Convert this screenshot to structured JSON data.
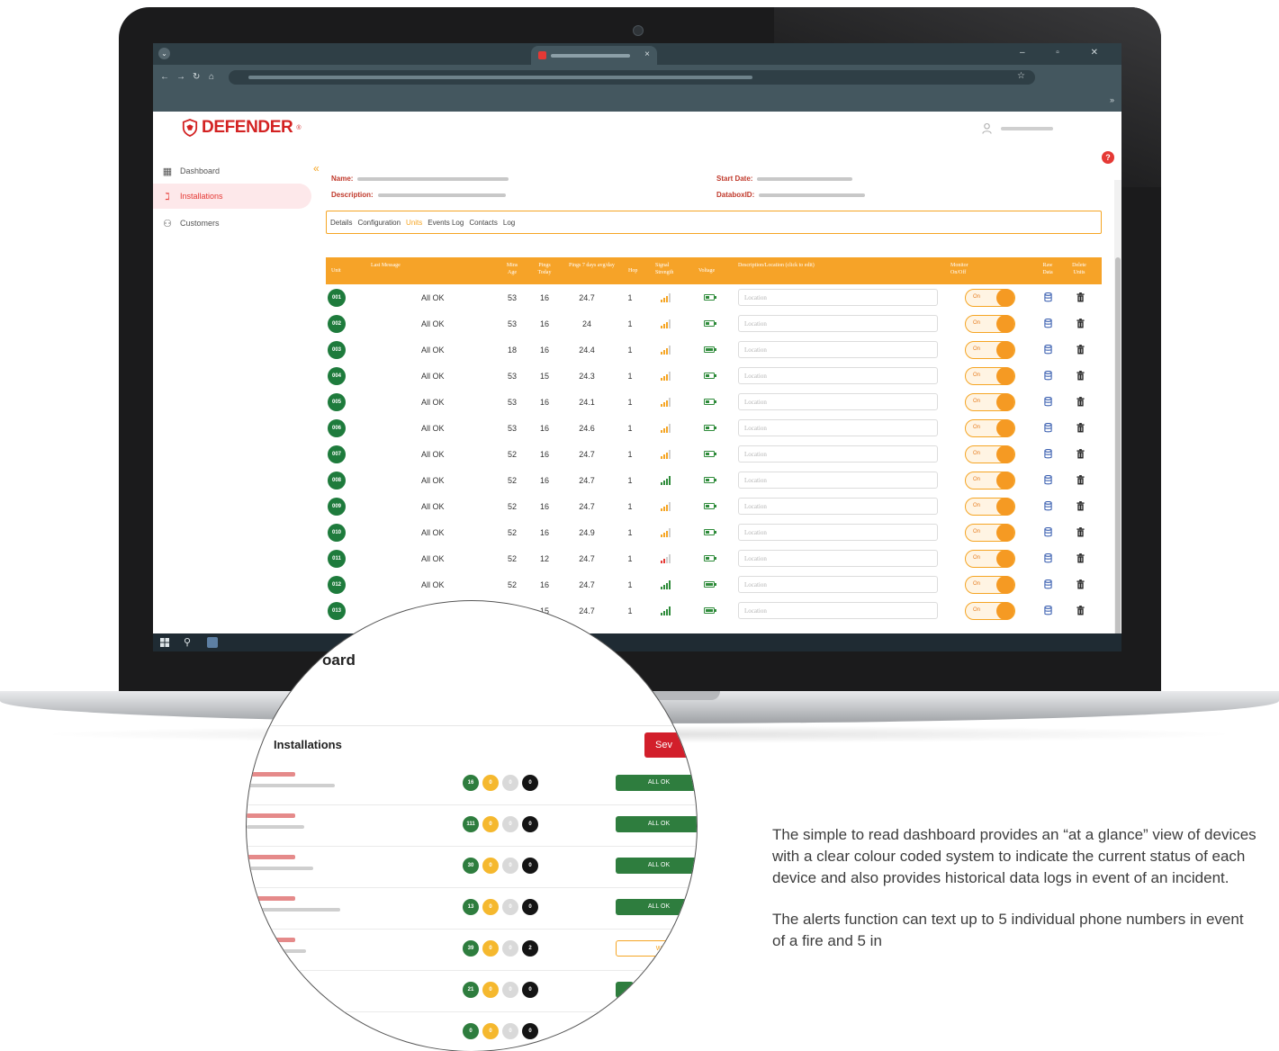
{
  "browser": {
    "window_controls": "–   ▫   ✕",
    "tab_close": "×"
  },
  "app": {
    "brand": "DEFENDER",
    "brand_mark": "®",
    "help_label": "?",
    "sidebar": [
      {
        "label": "Dashboard",
        "icon": "dashboard-grid-icon"
      },
      {
        "label": "Installations",
        "icon": "feed-icon",
        "active": true
      },
      {
        "label": "Customers",
        "icon": "users-icon"
      }
    ],
    "collapse_glyph": "«",
    "installation": {
      "name_key": "Name:",
      "description_key": "Description:",
      "start_date_key": "Start Date:",
      "databox_key": "DataboxID:"
    },
    "tabs": [
      {
        "label": "Details"
      },
      {
        "label": "Configuration"
      },
      {
        "label": "Units",
        "active": true
      },
      {
        "label": "Events Log"
      },
      {
        "label": "Contacts"
      },
      {
        "label": "Log"
      }
    ],
    "table": {
      "headers": {
        "unit": "Unit",
        "last_message": "Last Message",
        "mins_age": "Mins Age",
        "pings_today": "Pings Today",
        "pings_7days": "Pings 7 days avg/day",
        "hop": "Hop",
        "signal": "Signal Strength",
        "voltage": "Voltage",
        "description": "Description/Location (click to edit)",
        "monitor": "Monitor On/Off",
        "raw": "Raw Data",
        "delete": "Delete Units"
      },
      "location_placeholder": "Location",
      "toggle_label": "On",
      "rows": [
        {
          "unit": "001",
          "message": "All OK",
          "mins": "53",
          "pings": "16",
          "avg": "24.7",
          "hop": "1",
          "signal": 3,
          "signal_color": "orange",
          "battery": 0.55
        },
        {
          "unit": "002",
          "message": "All OK",
          "mins": "53",
          "pings": "16",
          "avg": "24",
          "hop": "1",
          "signal": 3,
          "signal_color": "orange",
          "battery": 0.55
        },
        {
          "unit": "003",
          "message": "All OK",
          "mins": "18",
          "pings": "16",
          "avg": "24.4",
          "hop": "1",
          "signal": 3,
          "signal_color": "orange",
          "battery": 1.0
        },
        {
          "unit": "004",
          "message": "All OK",
          "mins": "53",
          "pings": "15",
          "avg": "24.3",
          "hop": "1",
          "signal": 3,
          "signal_color": "orange",
          "battery": 0.55
        },
        {
          "unit": "005",
          "message": "All OK",
          "mins": "53",
          "pings": "16",
          "avg": "24.1",
          "hop": "1",
          "signal": 3,
          "signal_color": "orange",
          "battery": 0.55
        },
        {
          "unit": "006",
          "message": "All OK",
          "mins": "53",
          "pings": "16",
          "avg": "24.6",
          "hop": "1",
          "signal": 3,
          "signal_color": "orange",
          "battery": 0.55
        },
        {
          "unit": "007",
          "message": "All OK",
          "mins": "52",
          "pings": "16",
          "avg": "24.7",
          "hop": "1",
          "signal": 3,
          "signal_color": "orange",
          "battery": 0.55
        },
        {
          "unit": "008",
          "message": "All OK",
          "mins": "52",
          "pings": "16",
          "avg": "24.7",
          "hop": "1",
          "signal": 4,
          "signal_color": "green",
          "battery": 0.55
        },
        {
          "unit": "009",
          "message": "All OK",
          "mins": "52",
          "pings": "16",
          "avg": "24.7",
          "hop": "1",
          "signal": 3,
          "signal_color": "orange",
          "battery": 0.55
        },
        {
          "unit": "010",
          "message": "All OK",
          "mins": "52",
          "pings": "16",
          "avg": "24.9",
          "hop": "1",
          "signal": 3,
          "signal_color": "orange",
          "battery": 0.55
        },
        {
          "unit": "011",
          "message": "All OK",
          "mins": "52",
          "pings": "12",
          "avg": "24.7",
          "hop": "1",
          "signal": 2,
          "signal_color": "red",
          "battery": 0.55
        },
        {
          "unit": "012",
          "message": "All OK",
          "mins": "52",
          "pings": "16",
          "avg": "24.7",
          "hop": "1",
          "signal": 4,
          "signal_color": "green",
          "battery": 1.0
        },
        {
          "unit": "013",
          "message": "",
          "mins": "",
          "pings": "15",
          "avg": "24.7",
          "hop": "1",
          "signal": 4,
          "signal_color": "green",
          "battery": 1.0
        }
      ]
    }
  },
  "zoom": {
    "title_fragment": "oard",
    "section_title": "Installations",
    "button_fragment": "Sev",
    "rows": [
      {
        "counts": [
          "16",
          "0",
          "0",
          "0"
        ],
        "status": "ALL OK"
      },
      {
        "counts": [
          "111",
          "0",
          "0",
          "0"
        ],
        "status": "ALL OK"
      },
      {
        "counts": [
          "30",
          "0",
          "0",
          "0"
        ],
        "status": "ALL OK"
      },
      {
        "counts": [
          "13",
          "0",
          "0",
          "0"
        ],
        "status": "ALL OK"
      },
      {
        "counts": [
          "39",
          "0",
          "0",
          "2"
        ],
        "status": "W"
      },
      {
        "counts": [
          "21",
          "0",
          "0",
          "0"
        ],
        "status": ""
      },
      {
        "counts": [
          "0",
          "0",
          "0",
          "0"
        ],
        "status": ""
      }
    ]
  },
  "copy": {
    "p1": "The simple to read dashboard provides an “at a glance” view of devices with a clear colour coded system to indicate the current status of each device and also provides historical data logs in event of an incident.",
    "p2": "The alerts function can text up to 5 individual phone numbers in event of a fire and 5 in"
  },
  "colors": {
    "accent": "#f6a328",
    "brand_red": "#d32222",
    "ok_green": "#1e7b3c"
  }
}
